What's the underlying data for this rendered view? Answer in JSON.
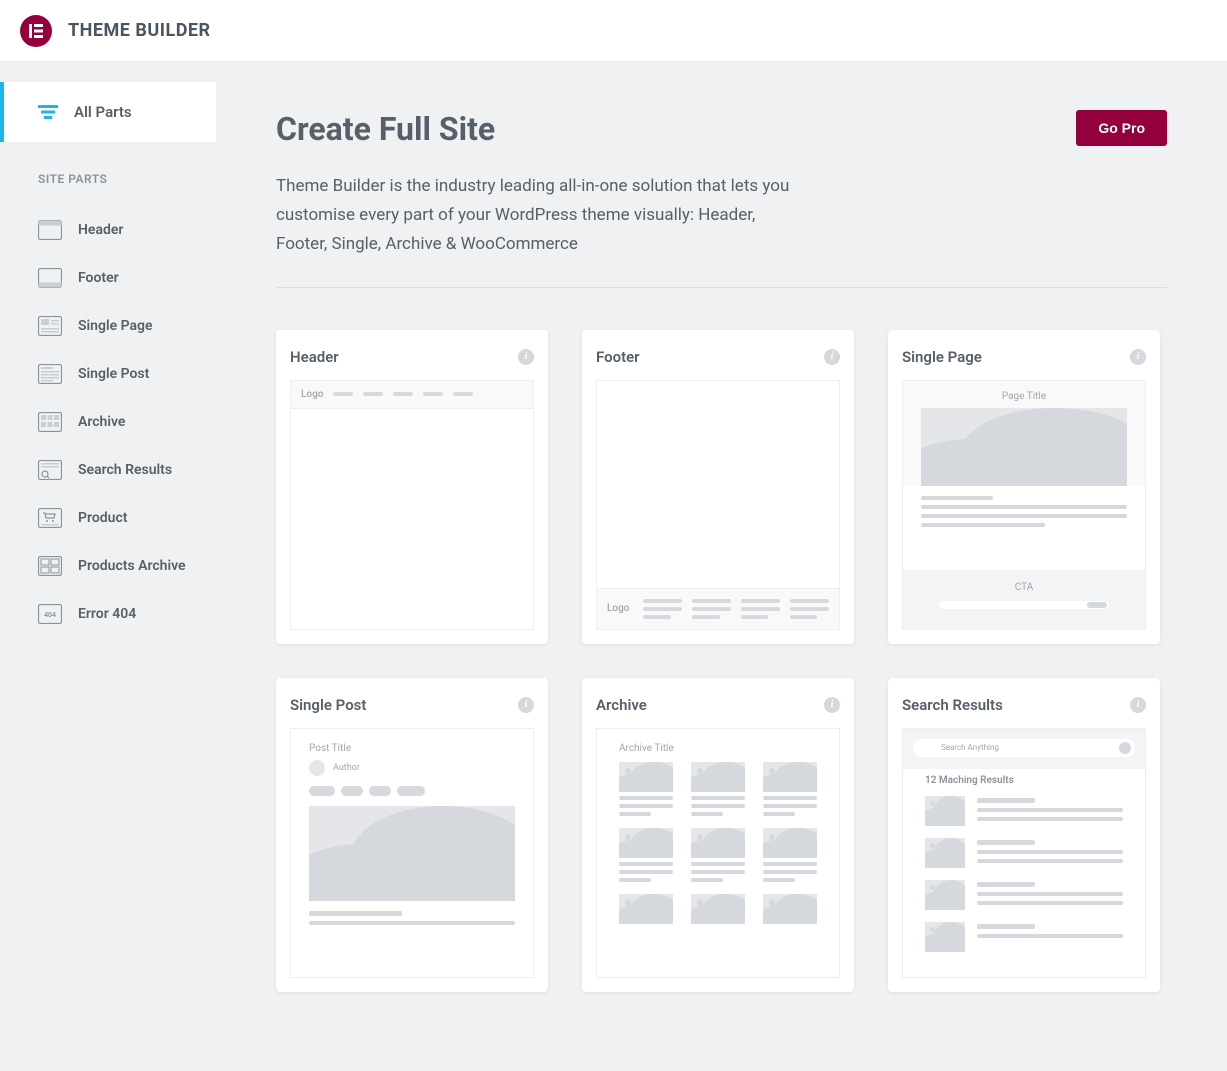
{
  "app_title": "THEME BUILDER",
  "sidebar": {
    "all_parts_label": "All Parts",
    "section_label": "SITE PARTS",
    "items": [
      {
        "label": "Header"
      },
      {
        "label": "Footer"
      },
      {
        "label": "Single Page"
      },
      {
        "label": "Single Post"
      },
      {
        "label": "Archive"
      },
      {
        "label": "Search Results"
      },
      {
        "label": "Product"
      },
      {
        "label": "Products Archive"
      },
      {
        "label": "Error 404"
      }
    ]
  },
  "page": {
    "title": "Create Full Site",
    "go_pro": "Go Pro",
    "description": "Theme Builder is the industry leading all-in-one solution that lets you customise every part of your WordPress theme visually: Header, Footer, Single, Archive & WooCommerce"
  },
  "cards": [
    {
      "title": "Header"
    },
    {
      "title": "Footer"
    },
    {
      "title": "Single Page"
    },
    {
      "title": "Single Post"
    },
    {
      "title": "Archive"
    },
    {
      "title": "Search Results"
    }
  ],
  "mock": {
    "logo": "Logo",
    "page_title": "Page Title",
    "cta": "CTA",
    "post_title": "Post Title",
    "author": "Author",
    "archive_title": "Archive Title",
    "search_placeholder": "Search Anything",
    "search_results": "12 Maching Results"
  }
}
